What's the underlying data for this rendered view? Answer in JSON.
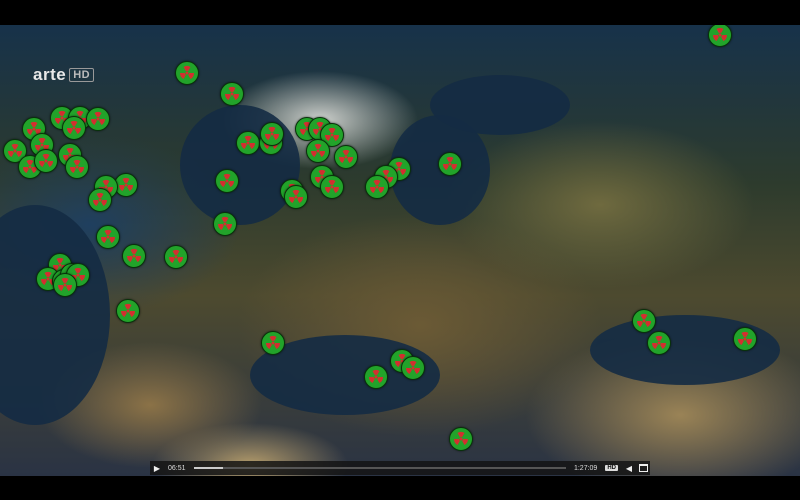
{
  "channel": {
    "name": "arte",
    "quality_badge": "HD"
  },
  "player": {
    "elapsed": "06:51",
    "duration": "1:27:09",
    "progress_fraction": 0.078,
    "hd_label": "HD",
    "play_icon": "play-icon",
    "volume_icon": "volume-icon",
    "fullscreen_icon": "window-icon"
  },
  "map": {
    "marker_icon": "radiation-trefoil-icon",
    "marker_color": "#22a32a",
    "marker_symbol_color": "#d32f2f"
  }
}
